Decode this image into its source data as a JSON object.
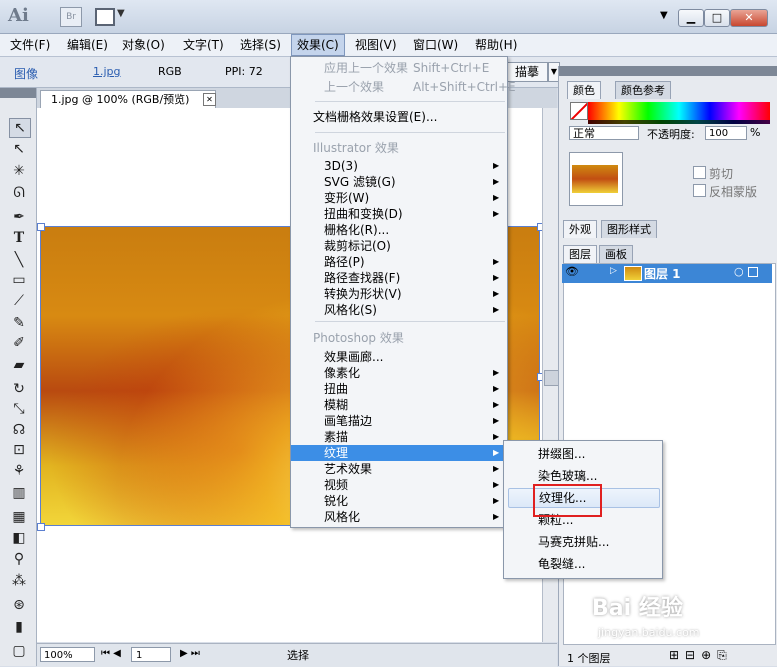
{
  "titlebar": {
    "logo": "Ai",
    "bridge": "Br",
    "arrange_arrow": "▼",
    "minimize": "▁",
    "maximize": "□",
    "close": "✕",
    "doc_arrow": "▼"
  },
  "menubar": {
    "items": [
      "文件(F)",
      "编辑(E)",
      "对象(O)",
      "文字(T)",
      "选择(S)",
      "效果(C)",
      "视图(V)",
      "窗口(W)",
      "帮助(H)"
    ]
  },
  "control": {
    "label": "图像",
    "file": "1.jpg",
    "mode": "RGB",
    "ppi": "PPI: 72",
    "trace": "描摹"
  },
  "document": {
    "tab_title": "1.jpg @ 100% (RGB/预览)",
    "close": "✕"
  },
  "status": {
    "zoom": "100%",
    "page": "1",
    "tool": "选择"
  },
  "panels": {
    "color_tab": "颜色",
    "color_guide_tab": "颜色参考",
    "blend_mode": "正常",
    "opacity_label": "不透明度:",
    "opacity": "100",
    "pct": "%",
    "clip": "剪切",
    "invert_mask": "反相蒙版",
    "appearance_tab": "外观",
    "graphic_styles_tab": "图形样式",
    "layers_tab": "图层",
    "artboards_tab": "画板",
    "layer_name": "图层 1",
    "layer_count": "1 个图层"
  },
  "effects_menu": {
    "apply_last": "应用上一个效果",
    "apply_last_sc": "Shift+Ctrl+E",
    "last": "上一个效果",
    "last_sc": "Alt+Shift+Ctrl+E",
    "raster_settings": "文档栅格效果设置(E)...",
    "illustrator_header": "Illustrator 效果",
    "illustrator_items": [
      "3D(3)",
      "SVG 滤镜(G)",
      "变形(W)",
      "扭曲和变换(D)",
      "栅格化(R)...",
      "裁剪标记(O)",
      "路径(P)",
      "路径查找器(F)",
      "转换为形状(V)",
      "风格化(S)"
    ],
    "photoshop_header": "Photoshop 效果",
    "photoshop_items": [
      "效果画廊...",
      "像素化",
      "扭曲",
      "模糊",
      "画笔描边",
      "素描",
      "纹理",
      "艺术效果",
      "视频",
      "锐化",
      "风格化"
    ],
    "highlighted": "纹理"
  },
  "texture_submenu": {
    "items": [
      "拼缀图...",
      "染色玻璃...",
      "纹理化...",
      "颗粒...",
      "马赛克拼贴...",
      "龟裂缝..."
    ],
    "hover": "纹理化..."
  },
  "watermark": {
    "text": "Bai 经验",
    "url": "jingyan.baidu.com"
  }
}
